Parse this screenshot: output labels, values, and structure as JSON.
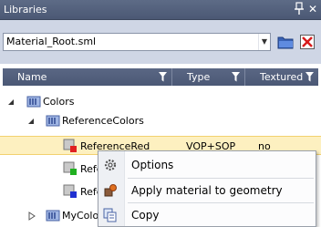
{
  "panel": {
    "title": "Libraries",
    "pin_icon": "pin-icon",
    "close_icon": "close-x"
  },
  "toolbar": {
    "library_combo": {
      "value": "Material_Root.sml"
    },
    "open_icon": "folder-open-icon",
    "delete_icon": "delete-red-x-icon"
  },
  "grid": {
    "columns": [
      {
        "label": "Name"
      },
      {
        "label": "Type"
      },
      {
        "label": "Textured"
      }
    ],
    "rows": [
      {
        "name": "Colors",
        "type": "",
        "textured": ""
      },
      {
        "name": "ReferenceColors",
        "type": "",
        "textured": ""
      },
      {
        "name": "ReferenceRed",
        "type": "VOP+SOP",
        "textured": "no"
      },
      {
        "name": "Refe",
        "type": "",
        "textured": ""
      },
      {
        "name": "Refe",
        "type": "",
        "textured": ""
      },
      {
        "name": "MyColo",
        "type": "",
        "textured": ""
      }
    ]
  },
  "context_menu": {
    "items": [
      {
        "label": "Options",
        "icon": "gear-icon"
      },
      {
        "label": "Apply material to geometry",
        "icon": "apply-material-icon"
      },
      {
        "label": "Copy",
        "icon": "copy-icon"
      }
    ]
  },
  "colors": {
    "header_bg": "#4b5875",
    "toolbar_bg": "#cfd6e5",
    "selection_bg": "#fdf0c0",
    "material_red": "#e02020",
    "material_green": "#20b020",
    "material_blue": "#2030d0"
  }
}
